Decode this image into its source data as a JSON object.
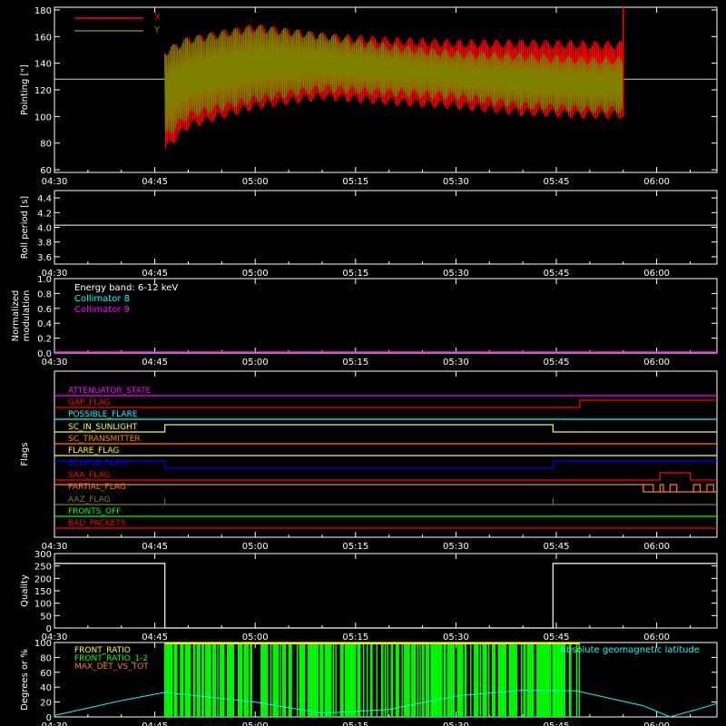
{
  "x_ticks": [
    "04:30",
    "04:45",
    "05:00",
    "05:15",
    "05:30",
    "05:45",
    "06:00"
  ],
  "colors": {
    "background": "#000000",
    "axes": "#ffffff",
    "x": "#ff0000",
    "y": "#808000",
    "collimator8": "#00ffff",
    "collimator9": "#ff00ff",
    "front_ratio": "#ffff00",
    "front_ratio_12": "#00ff00",
    "max_det_vs_tot": "#ff8000",
    "geomagnetic": "#00ffff"
  },
  "chart_data": [
    {
      "id": "pointing",
      "type": "line",
      "ylabel": "Pointing [\"]",
      "ylim": [
        58,
        182
      ],
      "yticks": [
        60,
        80,
        100,
        120,
        140,
        160,
        180
      ],
      "xlim_minutes": [
        0,
        99
      ],
      "reference_line": 128,
      "legend": [
        "X",
        "Y"
      ],
      "series": [
        {
          "name": "X",
          "envelope_upper": [
            [
              16,
              148
            ],
            [
              20,
              160
            ],
            [
              30,
              170
            ],
            [
              40,
              163
            ],
            [
              50,
              160
            ],
            [
              60,
              158
            ],
            [
              70,
              158
            ],
            [
              80,
              157
            ],
            [
              85,
              157
            ]
          ],
          "envelope_lower": [
            [
              16,
              70
            ],
            [
              20,
              90
            ],
            [
              30,
              105
            ],
            [
              40,
              112
            ],
            [
              50,
              108
            ],
            [
              60,
              105
            ],
            [
              70,
              100
            ],
            [
              80,
              98
            ],
            [
              85,
              98
            ]
          ]
        },
        {
          "name": "Y",
          "envelope_upper": [
            [
              16,
              150
            ],
            [
              20,
              160
            ],
            [
              30,
              169
            ],
            [
              40,
              163
            ],
            [
              50,
              155
            ],
            [
              60,
              150
            ],
            [
              70,
              148
            ],
            [
              80,
              145
            ],
            [
              85,
              145
            ]
          ],
          "envelope_lower": [
            [
              16,
              80
            ],
            [
              20,
              98
            ],
            [
              30,
              110
            ],
            [
              40,
              118
            ],
            [
              50,
              115
            ],
            [
              60,
              112
            ],
            [
              70,
              105
            ],
            [
              80,
              102
            ],
            [
              85,
              102
            ]
          ]
        }
      ],
      "data_range_minutes": [
        16.5,
        85
      ]
    },
    {
      "id": "roll",
      "type": "line",
      "ylabel": "Roll period [s]",
      "ylim": [
        3.5,
        4.5
      ],
      "yticks": [
        3.6,
        3.8,
        4.0,
        4.2,
        4.4
      ],
      "series": [
        {
          "name": "",
          "value": 4.03
        }
      ]
    },
    {
      "id": "modulation",
      "type": "line",
      "ylabel": "Normalized modulation",
      "ylim": [
        0,
        1
      ],
      "yticks": [
        0.0,
        0.2,
        0.4,
        0.6,
        0.8,
        1.0
      ],
      "legend": [
        "Energy band: 6-12 keV",
        "Collimator 8",
        "Collimator 9"
      ],
      "series": [
        {
          "name": "Collimator 9",
          "value": 0.0
        }
      ]
    },
    {
      "id": "flags",
      "type": "line",
      "ylabel": "Flags",
      "flags": [
        {
          "label": "ATTENUATOR_STATE",
          "color": "#ff00ff",
          "segments": [
            [
              0,
              99,
              0
            ]
          ]
        },
        {
          "label": "GAP_FLAG",
          "color": "#ff0000",
          "segments": [
            [
              0,
              78.5,
              0
            ],
            [
              78.5,
              99,
              1
            ]
          ]
        },
        {
          "label": "POSSIBLE_FLARE",
          "color": "#00ffff",
          "segments": [
            [
              0,
              99,
              0
            ]
          ]
        },
        {
          "label": "SC_IN_SUNLIGHT",
          "color": "#ffff00",
          "segments": [
            [
              0,
              16.5,
              0
            ],
            [
              16.5,
              74.5,
              1
            ],
            [
              74.5,
              99,
              0
            ]
          ]
        },
        {
          "label": "SC_TRANSMITTER",
          "color": "#ff8000",
          "segments": [
            [
              0,
              99,
              0
            ]
          ]
        },
        {
          "label": "FLARE_FLAG",
          "color": "#ffff00",
          "segments": [
            [
              0,
              99,
              0
            ]
          ]
        },
        {
          "label": "ECLIPSE_FLAG",
          "color": "#0000ff",
          "segments": [
            [
              0,
              16.5,
              1
            ],
            [
              16.5,
              74.5,
              0
            ],
            [
              74.5,
              99,
              1
            ]
          ]
        },
        {
          "label": "SAA_FLAG",
          "color": "#ff0000",
          "segments": [
            [
              0,
              90.5,
              0
            ],
            [
              90.5,
              95,
              1
            ],
            [
              95,
              99,
              0
            ]
          ]
        },
        {
          "label": "PARTIAL_FLAG",
          "color": "#ff8000",
          "segments": [
            [
              0,
              88,
              1
            ],
            [
              88,
              99,
              0
            ]
          ]
        },
        {
          "label": "AAZ_FLAG",
          "color": "#808000",
          "segments": [
            [
              0,
              99,
              0
            ]
          ]
        },
        {
          "label": "FRONTS_OFF",
          "color": "#00ff00",
          "segments": [
            [
              0,
              99,
              0
            ]
          ]
        },
        {
          "label": "BAD_PACKETS",
          "color": "#ff0000",
          "segments": [
            [
              0,
              99,
              0
            ]
          ]
        }
      ]
    },
    {
      "id": "quality",
      "type": "line",
      "ylabel": "Quality",
      "ylim": [
        0,
        300
      ],
      "yticks": [
        0,
        50,
        100,
        150,
        200,
        250,
        300
      ],
      "series": [
        {
          "name": "",
          "points": [
            [
              0,
              260
            ],
            [
              16.5,
              260
            ],
            [
              16.5,
              0
            ],
            [
              74.5,
              0
            ],
            [
              74.5,
              260
            ],
            [
              99,
              260
            ]
          ]
        }
      ]
    },
    {
      "id": "ratios",
      "type": "line",
      "ylabel": "Degrees or %",
      "ylim": [
        0,
        100
      ],
      "yticks": [
        0,
        20,
        40,
        60,
        80,
        100
      ],
      "legend": [
        "FRONT_RATIO",
        "FRONT_RATIO_1-2",
        "MAX_DET_VS_TOT"
      ],
      "right_legend": "Absolute geomagnetic latitude",
      "front_ratio_range_minutes": [
        16.5,
        78.5
      ],
      "geomagnetic_latitude": [
        [
          0,
          2
        ],
        [
          5,
          12
        ],
        [
          10,
          22
        ],
        [
          16.5,
          33
        ],
        [
          30,
          20
        ],
        [
          40,
          5
        ],
        [
          50,
          10
        ],
        [
          60,
          28
        ],
        [
          70,
          36
        ],
        [
          78,
          35
        ],
        [
          88,
          15
        ],
        [
          92,
          0
        ],
        [
          96,
          10
        ],
        [
          99,
          18
        ]
      ]
    }
  ]
}
